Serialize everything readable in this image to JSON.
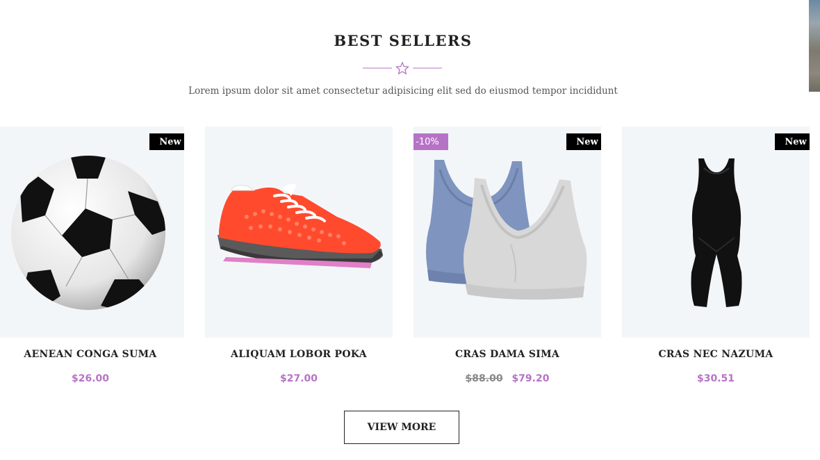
{
  "section": {
    "title": "BEST SELLERS",
    "subtitle": "Lorem ipsum dolor sit amet consectetur adipisicing elit sed do eiusmod tempor incididunt",
    "divider_icon": "star-outline-icon"
  },
  "colors": {
    "accent": "#b673c6",
    "badge_new_bg": "#000000",
    "card_bg": "#f3f6f9",
    "text": "#222222"
  },
  "products": [
    {
      "name": "AENEAN CONGA SUMA",
      "price": "$26.00",
      "old_price": "",
      "badge": "New",
      "sale_badge": "",
      "image": "soccer-ball"
    },
    {
      "name": "ALIQUAM LOBOR POKA",
      "price": "$27.00",
      "old_price": "",
      "badge": "",
      "sale_badge": "",
      "image": "running-shoe"
    },
    {
      "name": "CRAS DAMA SIMA",
      "price": "$79.20",
      "old_price": "$88.00",
      "badge": "New",
      "sale_badge": "-10%",
      "image": "sports-bras"
    },
    {
      "name": "CRAS NEC NAZUMA",
      "price": "$30.51",
      "old_price": "",
      "badge": "New",
      "sale_badge": "",
      "image": "bodysuit"
    }
  ],
  "view_more_label": "VIEW MORE"
}
